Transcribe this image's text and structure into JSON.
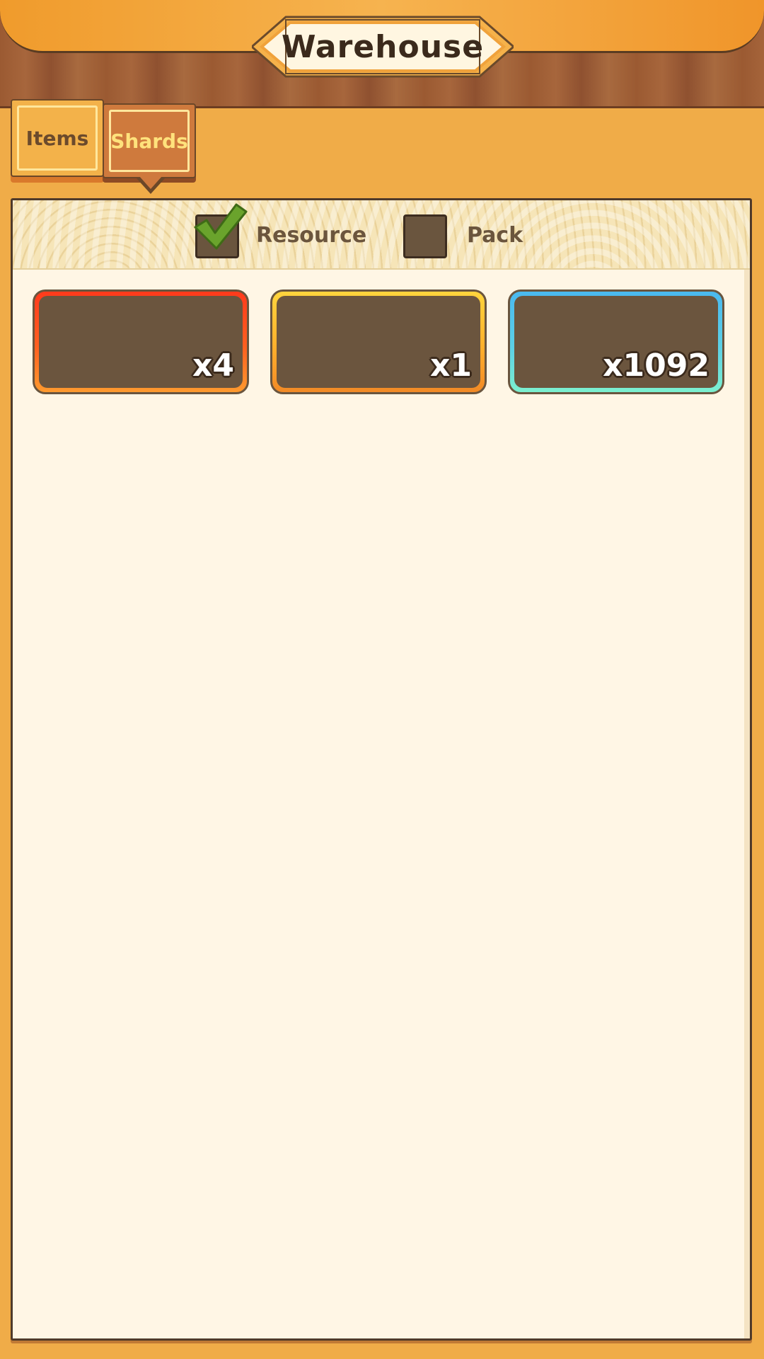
{
  "header": {
    "title": "Warehouse"
  },
  "tabs": [
    {
      "label": "Items",
      "selected": false
    },
    {
      "label": "Shards",
      "selected": true
    }
  ],
  "filters": [
    {
      "label": "Resource",
      "checked": true
    },
    {
      "label": "Pack",
      "checked": false
    }
  ],
  "items": [
    {
      "quantity": "x4",
      "rarity_color": "#ff4a1f"
    },
    {
      "quantity": "x1",
      "rarity_color": "#ffc631"
    },
    {
      "quantity": "x1092",
      "rarity_color": "#4ab9ef"
    }
  ],
  "colors": {
    "background": "#f0ac48",
    "panel": "#fff6e5",
    "slot": "#6b553e",
    "check": "#6aa32c"
  }
}
